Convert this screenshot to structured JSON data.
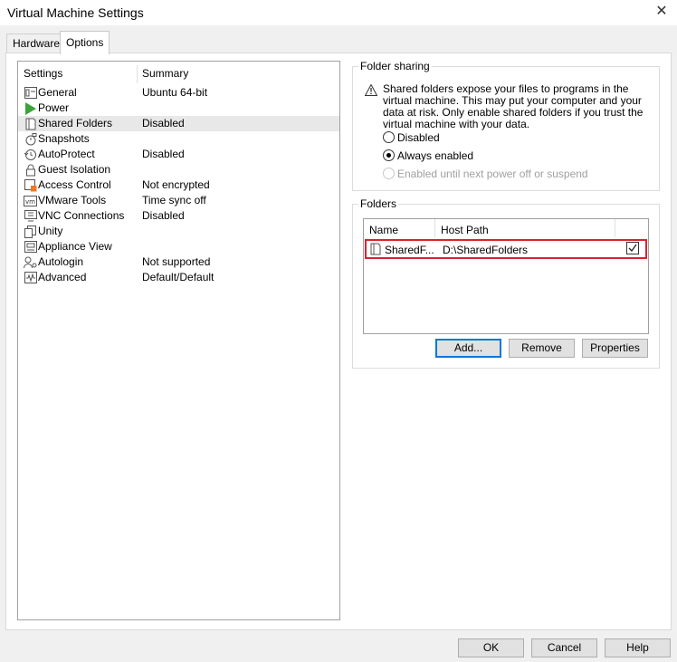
{
  "window": {
    "title": "Virtual Machine Settings",
    "close_glyph": "✕"
  },
  "tabs": [
    {
      "label": "Hardware",
      "active": false
    },
    {
      "label": "Options",
      "active": true
    }
  ],
  "settings": {
    "column_settings": "Settings",
    "column_summary": "Summary",
    "items": [
      {
        "icon": "general-icon",
        "label": "General",
        "summary": "Ubuntu 64-bit"
      },
      {
        "icon": "power-icon",
        "label": "Power",
        "summary": ""
      },
      {
        "icon": "shared-folders-icon",
        "label": "Shared Folders",
        "summary": "Disabled",
        "selected": true
      },
      {
        "icon": "snapshots-icon",
        "label": "Snapshots",
        "summary": ""
      },
      {
        "icon": "autoprotect-icon",
        "label": "AutoProtect",
        "summary": "Disabled"
      },
      {
        "icon": "guest-isolation-icon",
        "label": "Guest Isolation",
        "summary": ""
      },
      {
        "icon": "access-control-icon",
        "label": "Access Control",
        "summary": "Not encrypted"
      },
      {
        "icon": "vmware-tools-icon",
        "label": "VMware Tools",
        "summary": "Time sync off"
      },
      {
        "icon": "vnc-connections-icon",
        "label": "VNC Connections",
        "summary": "Disabled"
      },
      {
        "icon": "unity-icon",
        "label": "Unity",
        "summary": ""
      },
      {
        "icon": "appliance-view-icon",
        "label": "Appliance View",
        "summary": ""
      },
      {
        "icon": "autologin-icon",
        "label": "Autologin",
        "summary": "Not supported"
      },
      {
        "icon": "advanced-icon",
        "label": "Advanced",
        "summary": "Default/Default"
      }
    ]
  },
  "folder_sharing": {
    "title": "Folder sharing",
    "warning": "Shared folders expose your files to programs in the virtual machine. This may put your computer and your data at risk. Only enable shared folders if you trust the virtual machine with your data.",
    "options": [
      {
        "label": "Disabled",
        "checked": false,
        "enabled": true
      },
      {
        "label": "Always enabled",
        "checked": true,
        "enabled": true
      },
      {
        "label": "Enabled until next power off or suspend",
        "checked": false,
        "enabled": false
      }
    ]
  },
  "folders": {
    "title": "Folders",
    "col_name": "Name",
    "col_host_path": "Host Path",
    "rows": [
      {
        "name": "SharedF...",
        "host_path": "D:\\SharedFolders",
        "enabled": true
      }
    ],
    "buttons": {
      "add": "Add...",
      "remove": "Remove",
      "properties": "Properties"
    }
  },
  "footer": {
    "ok": "OK",
    "cancel": "Cancel",
    "help": "Help"
  },
  "colors": {
    "accent": "#0078d7",
    "highlight_border": "#d9232d",
    "power_green": "#3aa33a"
  }
}
